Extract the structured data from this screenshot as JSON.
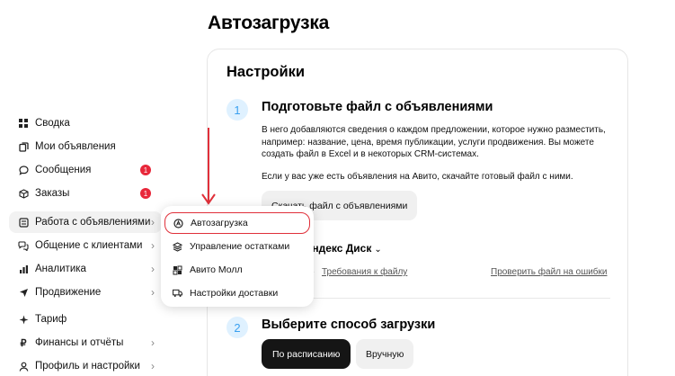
{
  "page": {
    "title": "Автозагрузка"
  },
  "sidebar": {
    "items": [
      {
        "label": "Сводка",
        "icon": "grid-icon"
      },
      {
        "label": "Мои объявления",
        "icon": "copy-icon"
      },
      {
        "label": "Сообщения",
        "icon": "chat-icon",
        "badge": "1"
      },
      {
        "label": "Заказы",
        "icon": "box-icon",
        "badge": "1"
      },
      {
        "label": "Работа с объявлениями",
        "icon": "list-icon",
        "has_chevron": true,
        "active": true
      },
      {
        "label": "Общение с клиентами",
        "icon": "chats-icon",
        "has_chevron": true
      },
      {
        "label": "Аналитика",
        "icon": "chart-icon",
        "has_chevron": true
      },
      {
        "label": "Продвижение",
        "icon": "rocket-icon",
        "has_chevron": true
      },
      {
        "label": "Тариф",
        "icon": "star-icon"
      },
      {
        "label": "Финансы и отчёты",
        "icon": "ruble-icon",
        "has_chevron": true
      },
      {
        "label": "Профиль и настройки",
        "icon": "person-icon",
        "has_chevron": true
      }
    ]
  },
  "popup": {
    "items": [
      {
        "label": "Автозагрузка",
        "icon": "autoload-icon",
        "highlighted": true
      },
      {
        "label": "Управление остатками",
        "icon": "layers-icon"
      },
      {
        "label": "Авито Молл",
        "icon": "mall-icon"
      },
      {
        "label": "Настройки доставки",
        "icon": "truck-icon"
      }
    ]
  },
  "settings": {
    "title": "Настройки",
    "step1": {
      "number": "1",
      "title": "Подготовьте файл с объявлениями",
      "desc1": "В него добавляются сведения о каждом предложении, которое нужно разместить, например: название, цена, время публикации, услуги продвижения. Вы можете создать файл в Excel и в некоторых CRM-системах.",
      "desc2": "Если у вас уже есть объявления на Авито, скачайте готовый файл с ними.",
      "download_button": "Скачать файл с объявлениями",
      "source_label": "ь Яндекс Диск",
      "requirements_link": "Требования к файлу",
      "check_link": "Проверить файл на ошибки"
    },
    "step2": {
      "number": "2",
      "title": "Выберите способ загрузки",
      "schedule_button": "По расписанию",
      "manual_button": "Вручную"
    }
  },
  "colors": {
    "accent_red": "#e0303a",
    "badge": "#e8273a",
    "step_bg": "#dff1ff",
    "step_fg": "#3aa0f0"
  }
}
